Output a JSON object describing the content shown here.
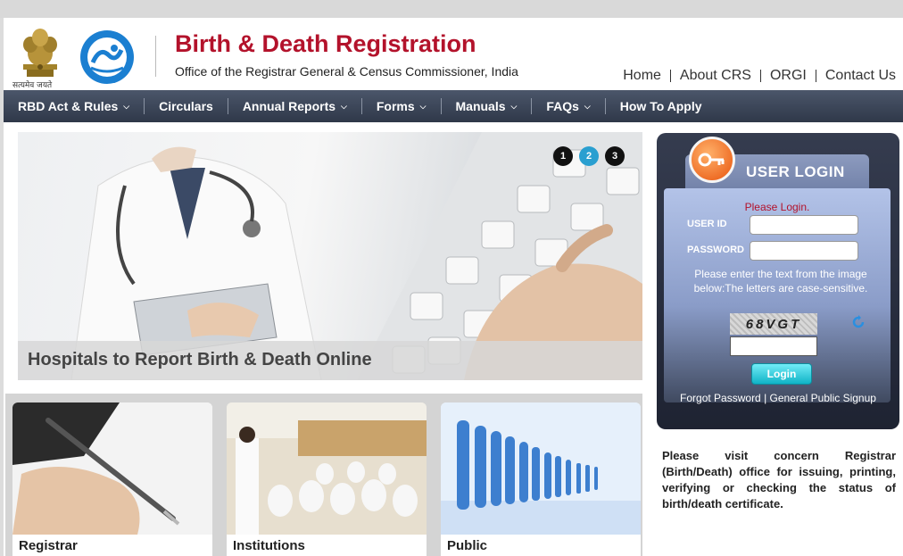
{
  "header": {
    "emblem_caption": "सत्यमेव जयते",
    "title": "Birth & Death Registration",
    "subtitle": "Office of the Registrar General & Census Commissioner, India",
    "links": [
      "Home",
      "About CRS",
      "ORGI",
      "Contact Us"
    ]
  },
  "nav": {
    "items": [
      {
        "label": "RBD Act & Rules",
        "dropdown": true
      },
      {
        "label": "Circulars",
        "dropdown": false
      },
      {
        "label": "Annual Reports",
        "dropdown": true
      },
      {
        "label": "Forms",
        "dropdown": true
      },
      {
        "label": "Manuals",
        "dropdown": true
      },
      {
        "label": "FAQs",
        "dropdown": true
      },
      {
        "label": "How To Apply",
        "dropdown": false
      }
    ]
  },
  "slider": {
    "caption": "Hospitals to Report Birth & Death Online",
    "dots": [
      "1",
      "2",
      "3"
    ],
    "active_dot": "2"
  },
  "login": {
    "title": "USER LOGIN",
    "message": "Please Login.",
    "user_id_label": "USER ID",
    "password_label": "PASSWORD",
    "captcha_help": "Please enter the text from the image below:The letters are case-sensitive.",
    "captcha_text": "68VGT",
    "button_label": "Login",
    "forgot_password": "Forgot Password",
    "link_separator": "|",
    "signup": "General Public Signup"
  },
  "notice": "Please visit concern Registrar (Birth/Death) office for issuing, printing, verifying or checking the status of birth/death certificate.",
  "tiles": [
    {
      "label": "Registrar"
    },
    {
      "label": "Institutions"
    },
    {
      "label": "Public"
    }
  ],
  "colors": {
    "title_red": "#b3122b",
    "nav_bg": "#3a4456",
    "active_dot": "#2a9fd0",
    "login_button": "#10b3c6"
  }
}
